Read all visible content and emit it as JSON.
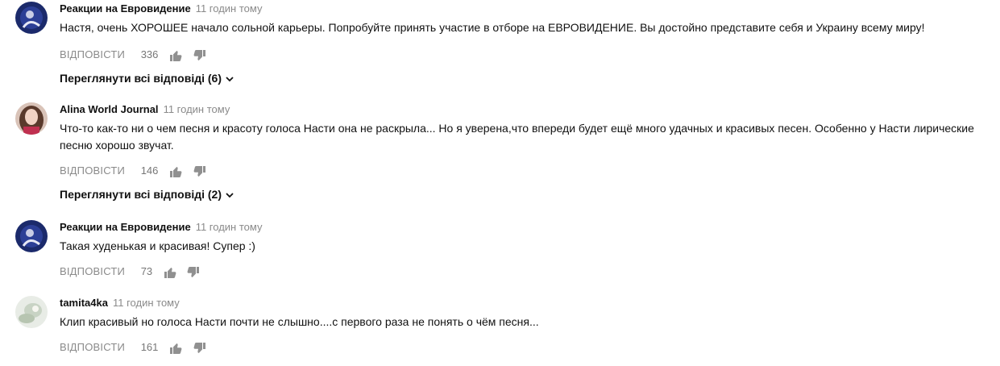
{
  "reply_label": "ВІДПОВІСТИ",
  "comments": [
    {
      "author": "Реакции на Евровидение",
      "time": "11 годин тому",
      "text": "Настя, очень ХОРОШЕЕ начало сольной карьеры. Попробуйте принять участие в отборе на ЕВРОВИДЕНИЕ. Вы достойно представите себя и Украину всему миру!",
      "likes": "336",
      "view_replies": "Переглянути всі відповіді (6)",
      "avatar": "avatar-dark-blue"
    },
    {
      "author": "Alina World Journal",
      "time": "11 годин тому",
      "text": "Что-то как-то ни о чем песня и красоту голоса Насти она не раскрыла... Но я уверена,что впереди будет ещё много удачных и красивых песен. Особенно у Насти лирические песню хорошо звучат.",
      "likes": "146",
      "view_replies": "Переглянути всі відповіді (2)",
      "avatar": "avatar-portrait"
    },
    {
      "author": "Реакции на Евровидение",
      "time": "11 годин тому",
      "text": "Такая худенькая и красивая! Супер :)",
      "likes": "73",
      "avatar": "avatar-dark-blue"
    },
    {
      "author": "tamita4ka",
      "time": "11 годин тому",
      "text": "Клип красивый но голоса Насти почти не слышно....с первого раза не понять о чём песня...",
      "likes": "161",
      "avatar": "avatar-light"
    }
  ]
}
